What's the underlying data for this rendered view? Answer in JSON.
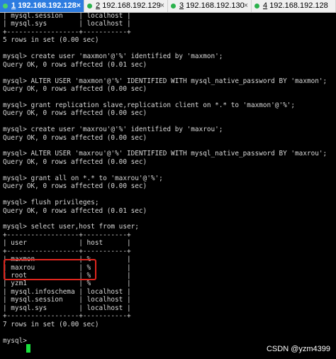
{
  "tabs": [
    {
      "num": "1",
      "label": "192.168.192.128",
      "active": true
    },
    {
      "num": "2",
      "label": "192.168.192.129",
      "active": false
    },
    {
      "num": "3",
      "label": "192.168.192.130",
      "active": false
    },
    {
      "num": "4",
      "label": "192.168.192.128",
      "active": false
    }
  ],
  "close_glyph": "×",
  "terminal_lines": [
    "| mysql.session    | localhost |",
    "| mysql.sys        | localhost |",
    "+------------------+-----------+",
    "5 rows in set (0.00 sec)",
    "",
    "mysql> create user 'maxmon'@'%' identified by 'maxmon';",
    "Query OK, 0 rows affected (0.01 sec)",
    "",
    "mysql> ALTER USER 'maxmon'@'%' IDENTIFIED WITH mysql_native_password BY 'maxmon';",
    "Query OK, 0 rows affected (0.00 sec)",
    "",
    "mysql> grant replication slave,replication client on *.* to 'maxmon'@'%';",
    "Query OK, 0 rows affected (0.00 sec)",
    "",
    "mysql> create user 'maxrou'@'%' identified by 'maxrou';",
    "Query OK, 0 rows affected (0.00 sec)",
    "",
    "mysql> ALTER USER 'maxrou'@'%' IDENTIFIED WITH mysql_native_password BY 'maxrou';",
    "Query OK, 0 rows affected (0.00 sec)",
    "",
    "mysql> grant all on *.* to 'maxrou'@'%';",
    "Query OK, 0 rows affected (0.00 sec)",
    "",
    "mysql> flush privileges;",
    "Query OK, 0 rows affected (0.01 sec)",
    "",
    "mysql> select user,host from user;",
    "+------------------+-----------+",
    "| user             | host      |",
    "+------------------+-----------+",
    "| maxmon           | %         |",
    "| maxrou           | %         |",
    "| root             | %         |",
    "| yzm1             | %         |",
    "| mysql.infoschema | localhost |",
    "| mysql.session    | localhost |",
    "| mysql.sys        | localhost |",
    "+------------------+-----------+",
    "7 rows in set (0.00 sec)",
    "",
    "mysql> "
  ],
  "watermark": "CSDN @yzm4399",
  "colors": {
    "cursor": "#19e03c",
    "highlight": "#e0261e",
    "active_tab": "#2d7ce0"
  }
}
